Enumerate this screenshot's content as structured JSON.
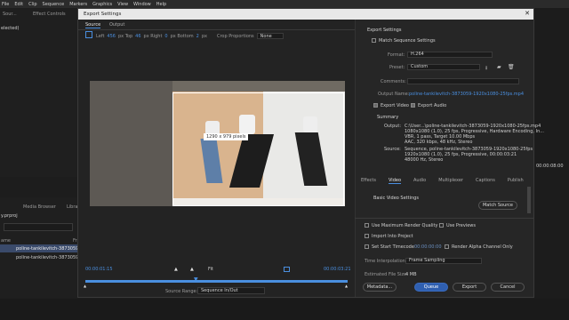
{
  "menu": [
    "File",
    "Edit",
    "Clip",
    "Sequence",
    "Markers",
    "Graphics",
    "View",
    "Window",
    "Help"
  ],
  "bg": {
    "tab_a": "Sour...",
    "tab_b": "Effect Controls",
    "selected": "elected)",
    "search": "y.prproj",
    "media_browser": "Media Browser",
    "lib": "Librar",
    "item1": "poline-tankilevitch-3873059",
    "item2": "poline-tankilevitch-3873059",
    "fr": "Fr",
    "name_col": "ame",
    "tc_right": "00:00:08:00"
  },
  "dialog": {
    "title": "Export Settings",
    "close": "✕",
    "tabs": [
      "Source",
      "Output"
    ],
    "crop": {
      "left_label": "Left",
      "left": "456",
      "top_label": "px Top",
      "top": "46",
      "right_label": "px Right",
      "right": "0",
      "bottom_label": "px Bottom",
      "bottom": "2",
      "px": "px",
      "proportions": "Crop Proportions",
      "proportions_value": "None"
    },
    "crop_size": "1290 x 979 pixels",
    "timecode_in": "00:00:01:15",
    "timecode_out": "00:00:03:21",
    "fit": "Fit",
    "source_range_label": "Source Range:",
    "source_range": "Sequence In/Out",
    "export_settings": "Export Settings",
    "match_sequence": "Match Sequence Settings",
    "format_label": "Format:",
    "format": "H.264",
    "preset_label": "Preset:",
    "preset": "Custom",
    "comments_label": "Comments:",
    "output_name_label": "Output Name:",
    "output_name": "poline-tankilevitch-3873059-1920x1080-25fps.mp4",
    "export_video": "Export Video",
    "export_audio": "Export Audio",
    "summary": "Summary",
    "output_label": "Output:",
    "output_lines": [
      "C:\\User...\\poline-tankilevitch-3873059-1920x1080-25fps.mp4",
      "1080x1080 (1.0), 25 fps, Progressive, Hardware Encoding, In...",
      "VBR, 1 pass, Target 10.00 Mbps",
      "AAC, 320 kbps, 48 kHz, Stereo"
    ],
    "source_label": "Source:",
    "source_lines": [
      "Sequence, poline-tankilevitch-3873059-1920x1080-25fps",
      "1920x1080 (1.0), 25 fps, Progressive, 00:00:03:21",
      "48000 Hz, Stereo"
    ],
    "settings_tabs": [
      "Effects",
      "Video",
      "Audio",
      "Multiplexer",
      "Captions",
      "Publish"
    ],
    "basic_video": "Basic Video Settings",
    "match_source": "Match Source",
    "opt": {
      "max_render": "Use Maximum Render Quality",
      "use_previews": "Use Previews",
      "import": "Import Into Project",
      "start_tc": "Set Start Timecode",
      "start_tc_val": "00:00:00:00",
      "alpha": "Render Alpha Channel Only"
    },
    "time_interp_label": "Time Interpolation:",
    "time_interp": "Frame Sampling",
    "file_size_label": "Estimated File Size:",
    "file_size": "4 MB",
    "buttons": {
      "metadata": "Metadata...",
      "queue": "Queue",
      "export": "Export",
      "cancel": "Cancel"
    }
  },
  "colors": {
    "accent": "#4a8fe0",
    "queue": "#2f5fb0"
  }
}
